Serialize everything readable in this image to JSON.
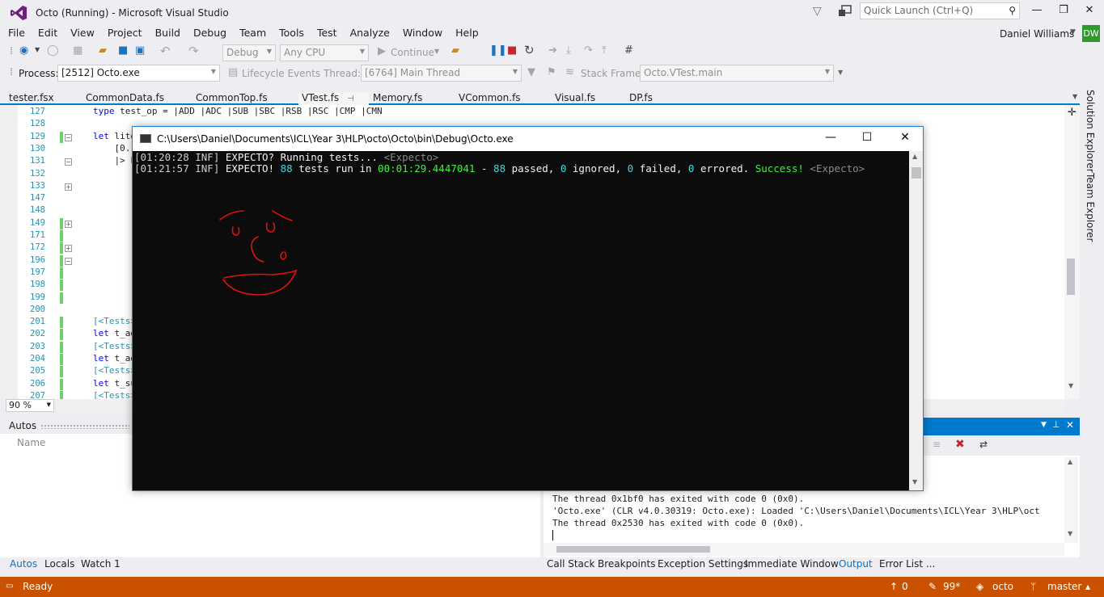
{
  "window": {
    "title": "Octo (Running) - Microsoft Visual Studio",
    "quick_launch_placeholder": "Quick Launch (Ctrl+Q)",
    "minimize": "—",
    "restore": "❐",
    "close": "✕"
  },
  "menu": [
    "File",
    "Edit",
    "View",
    "Project",
    "Build",
    "Debug",
    "Team",
    "Tools",
    "Test",
    "Analyze",
    "Window",
    "Help"
  ],
  "user": {
    "name": "Daniel Williams",
    "initials": "DW"
  },
  "toolbar": {
    "config": "Debug",
    "platform": "Any CPU",
    "continue_label": "Continue",
    "process_label": "Process:",
    "process_value": "[2512] Octo.exe",
    "lifecycle_label": "Lifecycle Events",
    "thread_label": "Thread:",
    "thread_value": "[6764] Main Thread",
    "stackframe_label": "Stack Frame:",
    "stackframe_value": "Octo.VTest.main"
  },
  "doc_tabs": [
    "tester.fsx",
    "CommonData.fs",
    "CommonTop.fs",
    "VTest.fs",
    "Memory.fs",
    "VCommon.fs",
    "Visual.fs",
    "DP.fs"
  ],
  "editor": {
    "line_numbers": [
      "127",
      "128",
      "129",
      "130",
      "131",
      "132",
      "133",
      "147",
      "148",
      "149",
      "171",
      "172",
      "196",
      "197",
      "198",
      "199",
      "200",
      "201",
      "202",
      "203",
      "204",
      "205",
      "206",
      "207"
    ],
    "code_lines": [
      {
        "kw": "type",
        "rest": " test_op = |ADD |ADC |SUB |SBC |RSB |RSC |CMP |CMN"
      },
      {
        "kw": "",
        "rest": ""
      },
      {
        "kw": "let",
        "rest": " lite"
      },
      {
        "kw": "",
        "rest": "    [0."
      },
      {
        "kw": "",
        "rest": "    |> L"
      },
      {
        "kw": "",
        "rest": ""
      },
      {
        "kw": "",
        "rest": ""
      },
      {
        "kw": "",
        "rest": ""
      },
      {
        "kw": "",
        "rest": ""
      },
      {
        "kw": "",
        "rest": ""
      },
      {
        "kw": "",
        "rest": ""
      },
      {
        "kw": "",
        "rest": ""
      },
      {
        "kw": "",
        "rest": ""
      },
      {
        "kw": "",
        "rest": ""
      },
      {
        "kw": "",
        "rest": ""
      },
      {
        "kw": "",
        "rest": ""
      },
      {
        "kw": "",
        "rest": ""
      },
      {
        "kw": "[<Tests>",
        "rest": ""
      },
      {
        "kw": "let",
        "rest": " t_ad"
      },
      {
        "kw": "[<Tests>",
        "rest": ""
      },
      {
        "kw": "let",
        "rest": " t_ad"
      },
      {
        "kw": "[<Tests>",
        "rest": ""
      },
      {
        "kw": "let",
        "rest": " t_su"
      },
      {
        "kw": "[<Tests>",
        "rest": ""
      }
    ],
    "zoom": "90 %"
  },
  "right_tabs": [
    "Solution Explorer",
    "Team Explorer"
  ],
  "autos": {
    "title": "Autos",
    "column_name": "Name",
    "tabs": [
      "Autos",
      "Locals",
      "Watch 1"
    ]
  },
  "output": {
    "lines": [
      "The thread 0x1bf0 has exited with code 0 (0x0).",
      "'Octo.exe' (CLR v4.0.30319: Octo.exe): Loaded 'C:\\Users\\Daniel\\Documents\\ICL\\Year 3\\HLP\\oct",
      "The thread 0x2530 has exited with code 0 (0x0)."
    ],
    "tabs": [
      "Call Stack",
      "Breakpoints",
      "Exception Settings",
      "Immediate Window",
      "Output",
      "Error List ..."
    ]
  },
  "status": {
    "ready": "Ready",
    "up_count": "0",
    "edit_count": "99*",
    "repo": "octo",
    "branch": "master"
  },
  "console": {
    "title": "C:\\Users\\Daniel\\Documents\\ICL\\Year 3\\HLP\\octo\\Octo\\bin\\Debug\\Octo.exe",
    "line1": {
      "time": "[01:20:28 INF]",
      "msg": " EXPECTO? Running tests... ",
      "src": "<Expecto>"
    },
    "line2": {
      "time": "[01:21:57 INF]",
      "prefix": " EXPECTO! ",
      "run_count": "88",
      "mid1": " tests run in ",
      "duration": "00:01:29.4447041",
      "mid2": " - ",
      "passed": "88",
      "mid3": " passed, ",
      "ignored": "0",
      "mid4": " ignored, ",
      "failed": "0",
      "mid5": " failed, ",
      "errored": "0",
      "mid6": " errored. ",
      "result": "Success!",
      "src": " <Expecto>"
    },
    "minimize": "—",
    "maximize": "☐",
    "close": "✕"
  }
}
